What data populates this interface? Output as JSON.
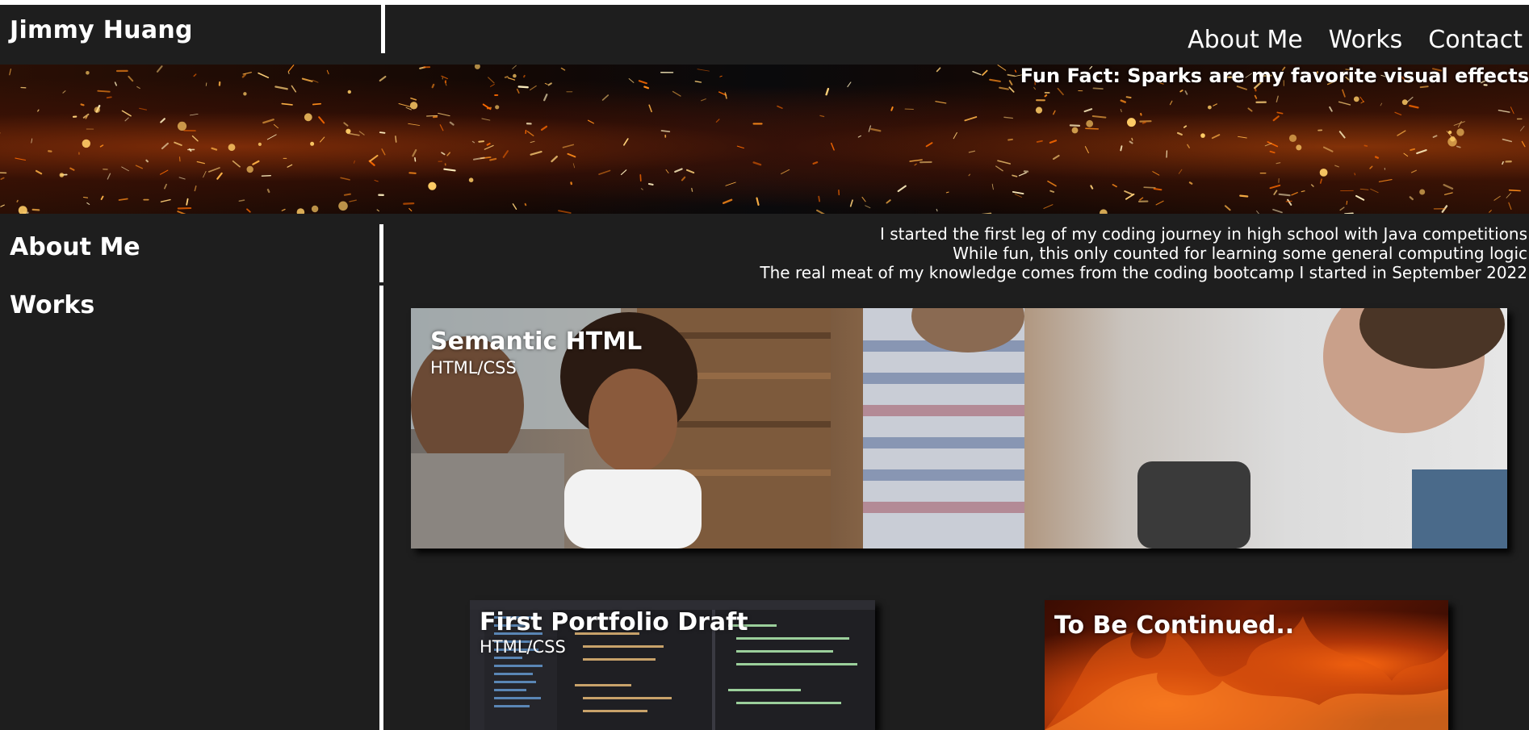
{
  "header": {
    "name": "Jimmy Huang",
    "nav": [
      {
        "label": "About Me"
      },
      {
        "label": "Works"
      },
      {
        "label": "Contact"
      }
    ]
  },
  "banner": {
    "fun_fact": "Fun Fact: Sparks are my favorite visual effects"
  },
  "sidebar": {
    "items": [
      {
        "label": "About Me"
      },
      {
        "label": "Works"
      }
    ]
  },
  "about": {
    "lines": [
      "I started the first leg of my coding journey in high school with Java competitions",
      "While fun, this only counted for learning some general computing logic",
      "The real meat of my knowledge comes from the coding bootcamp I started in September 2022"
    ]
  },
  "works": [
    {
      "title": "Semantic HTML",
      "subtitle": "HTML/CSS"
    },
    {
      "title": "First Portfolio Draft",
      "subtitle": "HTML/CSS"
    },
    {
      "title": "To Be Continued.."
    }
  ]
}
